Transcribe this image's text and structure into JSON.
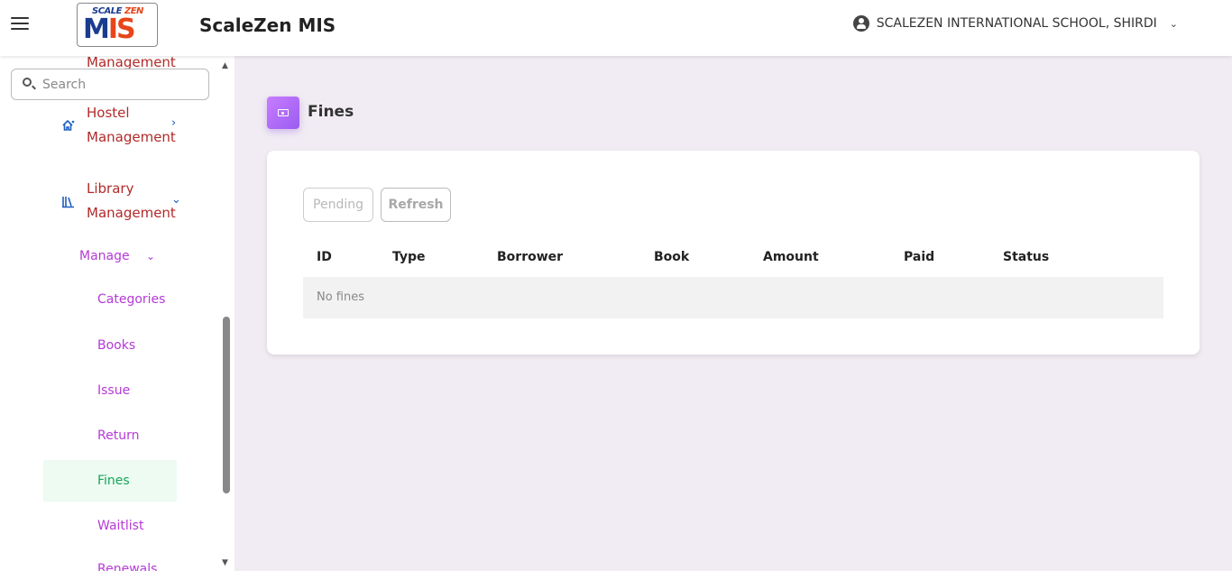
{
  "header": {
    "logo_top": "SCALE",
    "logo_top_accent": "ZEN",
    "logo_main": "M",
    "logo_main_accent": "IS",
    "app_title": "ScaleZen MIS",
    "school_name": "SCALEZEN INTERNATIONAL SCHOOL, SHIRDI"
  },
  "sidebar": {
    "search_placeholder": "Search",
    "cut_off_heading": "Management",
    "hostel": {
      "line1": "Hostel",
      "line2": "Management"
    },
    "library": {
      "line1": "Library",
      "line2": "Management"
    },
    "manage_label": "Manage",
    "items": [
      {
        "label": "Categories"
      },
      {
        "label": "Books"
      },
      {
        "label": "Issue"
      },
      {
        "label": "Return"
      },
      {
        "label": "Fines"
      },
      {
        "label": "Waitlist"
      },
      {
        "label": "Renewals"
      }
    ],
    "active_item": "Fines"
  },
  "main": {
    "page_title": "Fines",
    "buttons": {
      "pending": "Pending",
      "refresh": "Refresh"
    },
    "columns": [
      "ID",
      "Type",
      "Borrower",
      "Book",
      "Amount",
      "Paid",
      "Status"
    ],
    "empty_message": "No fines"
  },
  "colors": {
    "accent": "#b53ad6",
    "heading_red": "#b22a2a",
    "active_green": "#1aa35a",
    "page_icon": "#a865f2"
  }
}
